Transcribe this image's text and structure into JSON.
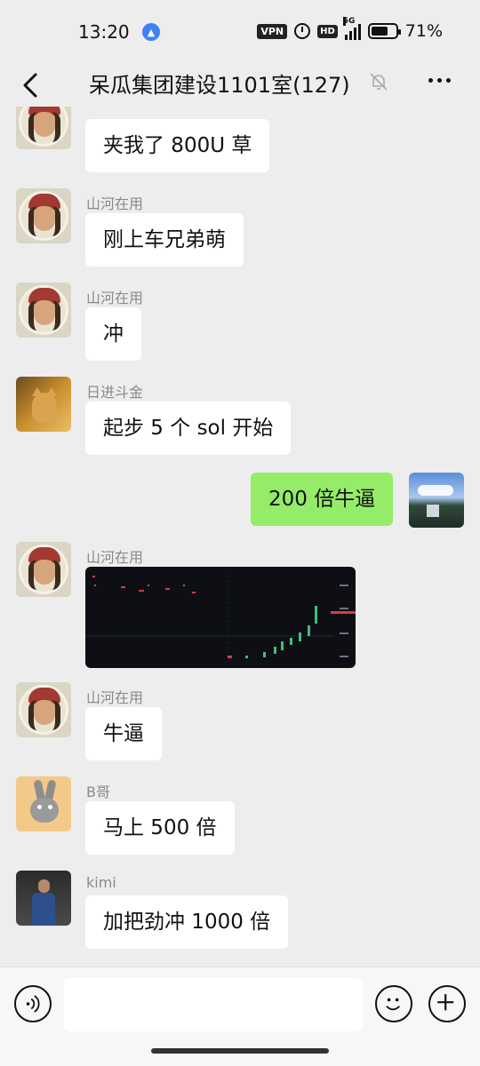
{
  "status_bar": {
    "time": "13:20",
    "vpn": "VPN",
    "hd": "HD",
    "network": "5G",
    "battery_percent": "71%",
    "battery_level": 0.71
  },
  "header": {
    "title": "呆瓜集团建设1101室(127)",
    "back_icon": "chevron-left-icon",
    "mute_icon": "bell-muted-icon",
    "more_icon": "more-horizontal-icon"
  },
  "messages": [
    {
      "sender": "",
      "text": "夹我了 800U 草",
      "side": "left",
      "avatar": "pirate"
    },
    {
      "sender": "山河在用",
      "text": "刚上车兄弟萌",
      "side": "left",
      "avatar": "pirate"
    },
    {
      "sender": "山河在用",
      "text": "冲",
      "side": "left",
      "avatar": "pirate"
    },
    {
      "sender": "日进斗金",
      "text": "起步 5 个 sol 开始",
      "side": "left",
      "avatar": "cat"
    },
    {
      "sender": "",
      "text": "200 倍牛逼",
      "side": "right",
      "avatar": "landscape"
    },
    {
      "sender": "山河在用",
      "text": "",
      "side": "left",
      "avatar": "pirate",
      "type": "image"
    },
    {
      "sender": "山河在用",
      "text": "牛逼",
      "side": "left",
      "avatar": "pirate"
    },
    {
      "sender": "B哥",
      "text": "马上 500 倍",
      "side": "left",
      "avatar": "rabbit"
    },
    {
      "sender": "kimi",
      "text": "加把劲冲 1000 倍",
      "side": "left",
      "avatar": "person"
    }
  ],
  "input_bar": {
    "voice_icon": "voice-icon",
    "emoji_icon": "emoji-icon",
    "plus_icon": "plus-icon",
    "placeholder": ""
  },
  "colors": {
    "background": "#ededed",
    "bubble_left": "#ffffff",
    "bubble_right": "#95ec69",
    "sender_text": "#8a8a8a"
  }
}
